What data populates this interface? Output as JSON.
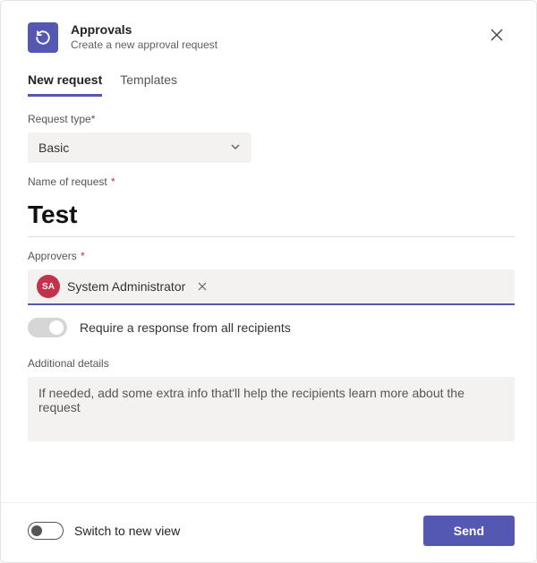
{
  "header": {
    "title": "Approvals",
    "subtitle": "Create a new approval request"
  },
  "tabs": [
    {
      "label": "New request",
      "active": true
    },
    {
      "label": "Templates",
      "active": false
    }
  ],
  "form": {
    "requestType": {
      "label": "Request type*",
      "value": "Basic"
    },
    "name": {
      "label": "Name of request",
      "value": "Test"
    },
    "approvers": {
      "label": "Approvers",
      "chip": {
        "initials": "SA",
        "name": "System Administrator"
      }
    },
    "requireAll": {
      "label": "Require a response from all recipients",
      "on": false
    },
    "details": {
      "label": "Additional details",
      "placeholder": "If needed, add some extra info that'll help the recipients learn more about the request"
    }
  },
  "footer": {
    "switchLabel": "Switch to new view",
    "sendLabel": "Send"
  }
}
